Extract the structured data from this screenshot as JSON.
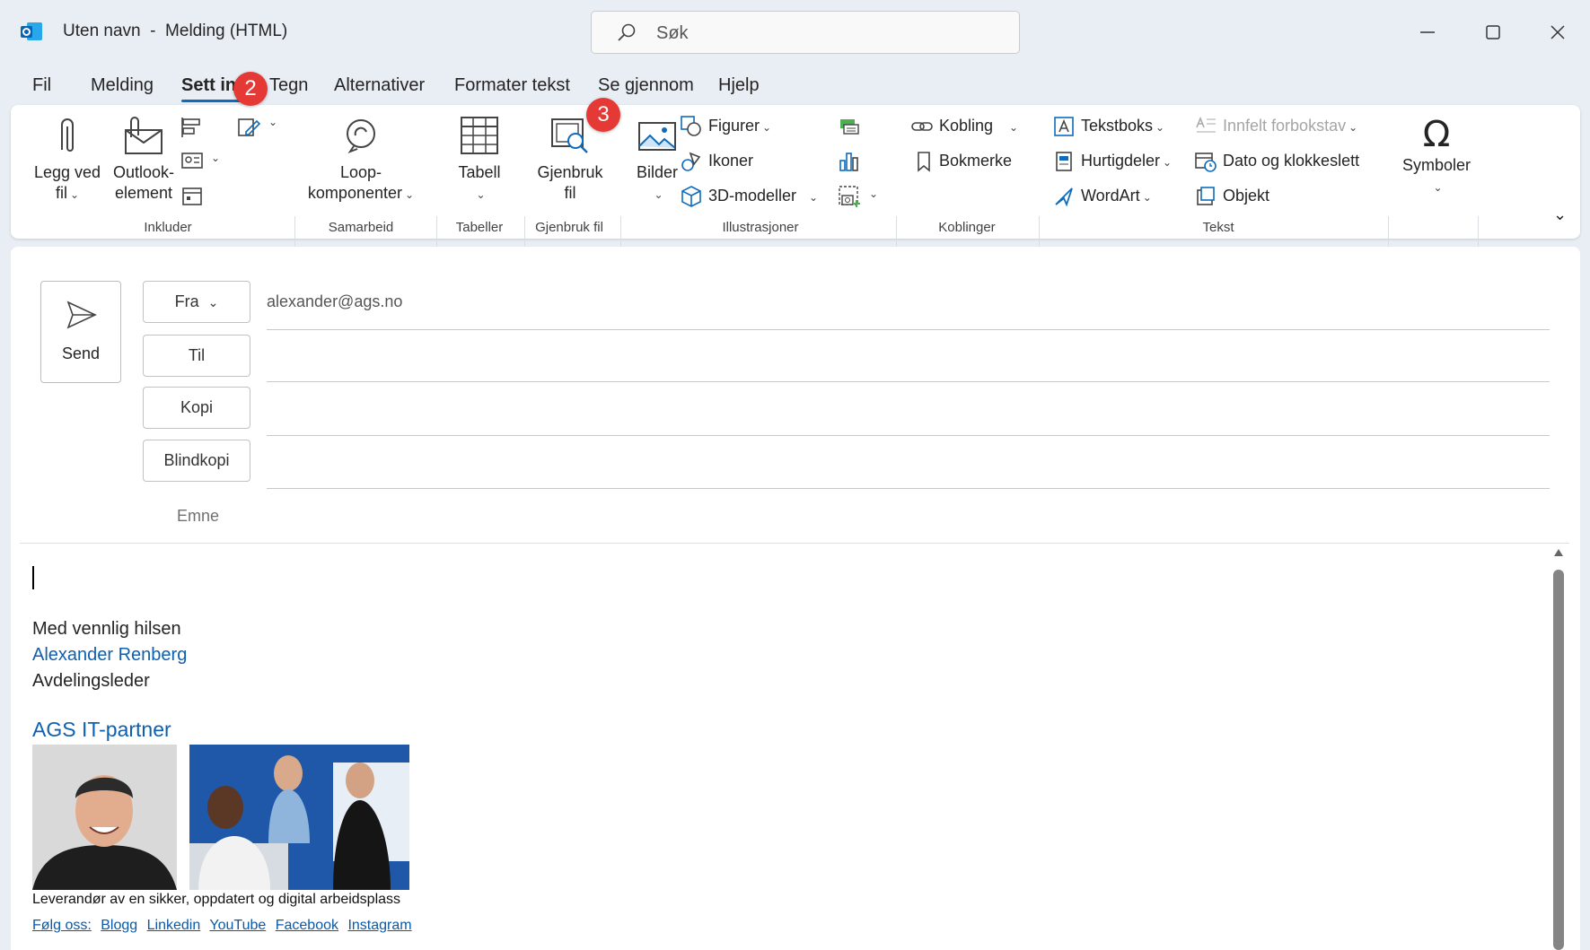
{
  "window": {
    "title": "Uten navn  -  Melding (HTML)"
  },
  "search": {
    "placeholder": "Søk"
  },
  "menu": [
    "Fil",
    "Melding",
    "Sett inn",
    "Tegn",
    "Alternativer",
    "Formater tekst",
    "Se gjennom",
    "Hjelp"
  ],
  "active_tab": "Sett inn",
  "ribbon": {
    "attach": {
      "line1": "Legg ved",
      "line2": "fil"
    },
    "outlook_item": {
      "line1": "Outlook-",
      "line2": "element"
    },
    "group_include": "Inkluder",
    "loop": {
      "line1": "Loop-",
      "line2": "komponenter"
    },
    "group_collab": "Samarbeid",
    "table": {
      "line1": "Tabell"
    },
    "group_tables": "Tabeller",
    "reuse": {
      "line1": "Gjenbruk",
      "line2": "fil"
    },
    "group_reuse": "Gjenbruk fil",
    "pictures": {
      "line1": "Bilder"
    },
    "shapes": "Figurer",
    "icons": "Ikoner",
    "models3d": "3D-modeller",
    "group_illus": "Illustrasjoner",
    "link": "Kobling",
    "bookmark": "Bokmerke",
    "group_links": "Koblinger",
    "textbox": "Tekstboks",
    "quickparts": "Hurtigdeler",
    "wordart": "WordArt",
    "dropcap": "Innfelt forbokstav",
    "datetime": "Dato og klokkeslett",
    "object": "Objekt",
    "group_text": "Tekst",
    "symbols": {
      "line1": "Symboler"
    }
  },
  "compose": {
    "send": "Send",
    "from_btn": "Fra",
    "to_btn": "Til",
    "cc_btn": "Kopi",
    "bcc_btn": "Blindkopi",
    "from_value": "alexander@ags.no",
    "subject_label": "Emne"
  },
  "signature": {
    "greeting": "Med vennlig hilsen",
    "name": "Alexander Renberg",
    "title": "Avdelingsleder",
    "company": "AGS IT-partner",
    "tagline": "Leverandør av en sikker, oppdatert og digital arbeidsplass",
    "follow": "Følg oss:",
    "links": [
      "Blogg",
      "Linkedin",
      "YouTube",
      "Facebook",
      "Instagram"
    ]
  },
  "badges": [
    "2",
    "3"
  ],
  "colors": {
    "accent": "#0f6cbd",
    "badge": "#e53935",
    "link": "#0f5fb0"
  }
}
